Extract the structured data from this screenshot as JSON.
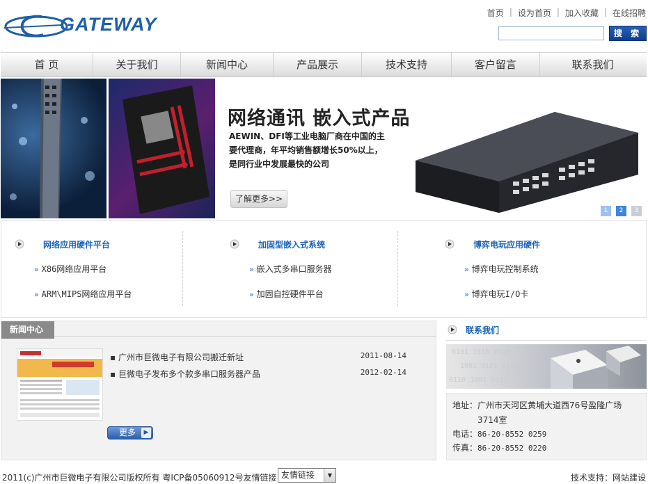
{
  "header": {
    "logo_text": "GATEWAY",
    "top_links": [
      "首页",
      "设为首页",
      "加入收藏",
      "在线招聘"
    ],
    "search": {
      "placeholder": "",
      "button_label": "搜 索"
    }
  },
  "nav": [
    "首 页",
    "关于我们",
    "新闻中心",
    "产品展示",
    "技术支持",
    "客户留言",
    "联系我们"
  ],
  "banner": {
    "title": "网络通讯  嵌入式产品",
    "desc_line1": "AEWIN、DFI等工业电脑厂商在中国的主",
    "desc_line2": "要代理商，年平均销售额增长50%以上，",
    "desc_line3": "是同行业中发展最快的公司",
    "more_label": "了解更多>>",
    "slides": [
      "1",
      "2",
      "3"
    ],
    "active_slide": 2
  },
  "products": [
    {
      "title": "网络应用硬件平台",
      "links": [
        "X86网络应用平台",
        "ARM\\MIPS网络应用平台"
      ]
    },
    {
      "title": "加固型嵌入式系统",
      "links": [
        "嵌入式多串口服务器",
        "加固自控硬件平台"
      ]
    },
    {
      "title": "博弈电玩应用硬件",
      "links": [
        "博弈电玩控制系统",
        "博弈电玩I/O卡"
      ]
    }
  ],
  "news": {
    "tab_label": "新闻中心",
    "items": [
      {
        "title": "广州市巨微电子有限公司搬迁新址",
        "date": "2011-08-14"
      },
      {
        "title": "巨微电子发布多个款多串口服务器产品",
        "date": "2012-02-14"
      }
    ],
    "more_label": "更多"
  },
  "contact": {
    "title": "联系我们",
    "address_label": "地址：",
    "address_line1": "广州市天河区黄埔大道西76号盈隆广场",
    "address_line2": "3714室",
    "phone_label": "电话：",
    "phone": "86-20-8552 0259",
    "fax_label": "传真：",
    "fax": "86-20-8552 0220"
  },
  "footer": {
    "copyright": "2011(c)广州市巨微电子有限公司版权所有 粤ICP备05060912号友情链接：",
    "friend_links_selected": "友情链接",
    "tech_support": "技术支持：网站建设"
  },
  "colors": {
    "brand_blue": "#1f5fa6",
    "link_blue": "#1a62b7",
    "tab_gray": "#8a8a8a"
  }
}
